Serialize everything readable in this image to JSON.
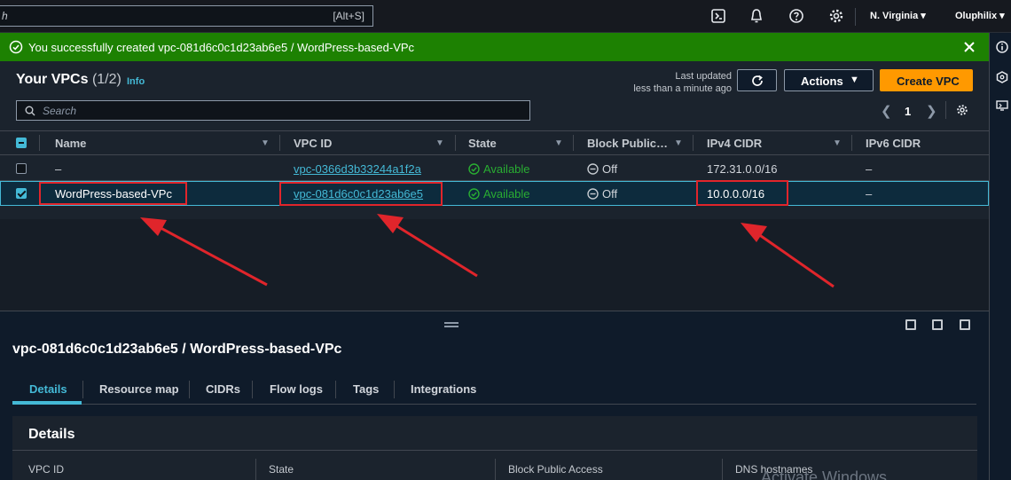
{
  "topnav": {
    "search_placeholder": "h",
    "search_shortcut": "[Alt+S]",
    "region": "N. Virginia ▾",
    "user": "Oluphilix ▾",
    "icons": [
      "cloudshell-icon",
      "bell-icon",
      "help-icon",
      "gear-icon"
    ]
  },
  "flash": {
    "message": "You successfully created vpc-081d6c0c1d23ab6e5 / WordPress-based-VPc"
  },
  "panel": {
    "title": "Your VPCs",
    "count": "(1/2)",
    "info": "Info",
    "last_updated_line1": "Last updated",
    "last_updated_line2": "less than a minute ago",
    "actions_label": "Actions",
    "create_label": "Create VPC",
    "filter_placeholder": "Search",
    "page_number": "1"
  },
  "table": {
    "columns": [
      "Name",
      "VPC ID",
      "State",
      "Block Public…",
      "IPv4 CIDR",
      "IPv6 CIDR"
    ],
    "rows": [
      {
        "selected": false,
        "name": "–",
        "vpc_id": "vpc-0366d3b33244a1f2a",
        "state": "Available",
        "block": "Off",
        "ipv4": "172.31.0.0/16",
        "ipv6": "–"
      },
      {
        "selected": true,
        "name": "WordPress-based-VPc",
        "vpc_id": "vpc-081d6c0c1d23ab6e5",
        "state": "Available",
        "block": "Off",
        "ipv4": "10.0.0.0/16",
        "ipv6": "–"
      }
    ]
  },
  "split": {
    "title": "vpc-081d6c0c1d23ab6e5 / WordPress-based-VPc",
    "tabs": [
      "Details",
      "Resource map",
      "CIDRs",
      "Flow logs",
      "Tags",
      "Integrations"
    ],
    "details_heading": "Details",
    "detail_labels": [
      "VPC ID",
      "State",
      "Block Public Access",
      "DNS hostnames"
    ],
    "watermark": "Activate Windows"
  },
  "colors": {
    "success": "#1d8102",
    "accent": "#44b9d6",
    "primary": "#ff9900",
    "annotation": "#e0252b"
  }
}
